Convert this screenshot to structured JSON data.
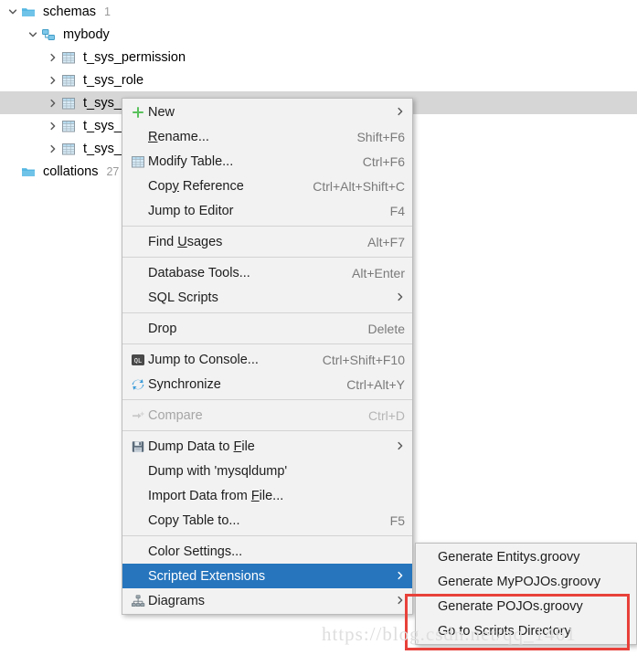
{
  "tree": {
    "rows": [
      {
        "label": "schemas",
        "count": "1",
        "indent": 0,
        "chevron": "down",
        "icon": "folder-icon",
        "selected": false
      },
      {
        "label": "mybody",
        "count": "",
        "indent": 1,
        "chevron": "down",
        "icon": "schema-icon",
        "selected": false
      },
      {
        "label": "t_sys_permission",
        "count": "",
        "indent": 2,
        "chevron": "right",
        "icon": "table-icon",
        "selected": false
      },
      {
        "label": "t_sys_role",
        "count": "",
        "indent": 2,
        "chevron": "right",
        "icon": "table-icon",
        "selected": false
      },
      {
        "label": "t_sys_",
        "count": "",
        "indent": 2,
        "chevron": "right",
        "icon": "table-icon",
        "selected": true
      },
      {
        "label": "t_sys_",
        "count": "",
        "indent": 2,
        "chevron": "right",
        "icon": "table-icon",
        "selected": false
      },
      {
        "label": "t_sys_",
        "count": "",
        "indent": 2,
        "chevron": "right",
        "icon": "table-icon",
        "selected": false
      },
      {
        "label": "collations",
        "count": "27",
        "indent": 0,
        "chevron": "",
        "icon": "folder-icon",
        "selected": false
      }
    ]
  },
  "context_menu": {
    "items": [
      {
        "type": "item",
        "label": "New",
        "accel": "",
        "icon": "plus-icon",
        "arrow": true,
        "disabled": false,
        "selected": false
      },
      {
        "type": "item",
        "label": "Rename...",
        "accel": "Shift+F6",
        "icon": "",
        "arrow": false,
        "disabled": false,
        "selected": false,
        "mnemonic": "R"
      },
      {
        "type": "item",
        "label": "Modify Table...",
        "accel": "Ctrl+F6",
        "icon": "table-icon",
        "arrow": false,
        "disabled": false,
        "selected": false
      },
      {
        "type": "item",
        "label": "Copy Reference",
        "accel": "Ctrl+Alt+Shift+C",
        "icon": "",
        "arrow": false,
        "disabled": false,
        "selected": false,
        "mnemonic": "y"
      },
      {
        "type": "item",
        "label": "Jump to Editor",
        "accel": "F4",
        "icon": "",
        "arrow": false,
        "disabled": false,
        "selected": false
      },
      {
        "type": "separator"
      },
      {
        "type": "item",
        "label": "Find Usages",
        "accel": "Alt+F7",
        "icon": "",
        "arrow": false,
        "disabled": false,
        "selected": false,
        "mnemonic": "U"
      },
      {
        "type": "separator"
      },
      {
        "type": "item",
        "label": "Database Tools...",
        "accel": "Alt+Enter",
        "icon": "",
        "arrow": false,
        "disabled": false,
        "selected": false
      },
      {
        "type": "item",
        "label": "SQL Scripts",
        "accel": "",
        "icon": "",
        "arrow": true,
        "disabled": false,
        "selected": false
      },
      {
        "type": "separator"
      },
      {
        "type": "item",
        "label": "Drop",
        "accel": "Delete",
        "icon": "",
        "arrow": false,
        "disabled": false,
        "selected": false
      },
      {
        "type": "separator"
      },
      {
        "type": "item",
        "label": "Jump to Console...",
        "accel": "Ctrl+Shift+F10",
        "icon": "sql-console-icon",
        "arrow": false,
        "disabled": false,
        "selected": false
      },
      {
        "type": "item",
        "label": "Synchronize",
        "accel": "Ctrl+Alt+Y",
        "icon": "sync-icon",
        "arrow": false,
        "disabled": false,
        "selected": false
      },
      {
        "type": "separator"
      },
      {
        "type": "item",
        "label": "Compare",
        "accel": "Ctrl+D",
        "icon": "compare-icon",
        "arrow": false,
        "disabled": true,
        "selected": false
      },
      {
        "type": "separator"
      },
      {
        "type": "item",
        "label": "Dump Data to File",
        "accel": "",
        "icon": "save-icon",
        "arrow": true,
        "disabled": false,
        "selected": false,
        "mnemonic": "F"
      },
      {
        "type": "item",
        "label": "Dump with 'mysqldump'",
        "accel": "",
        "icon": "",
        "arrow": false,
        "disabled": false,
        "selected": false
      },
      {
        "type": "item",
        "label": "Import Data from File...",
        "accel": "",
        "icon": "",
        "arrow": false,
        "disabled": false,
        "selected": false,
        "mnemonic": "F"
      },
      {
        "type": "item",
        "label": "Copy Table to...",
        "accel": "F5",
        "icon": "",
        "arrow": false,
        "disabled": false,
        "selected": false
      },
      {
        "type": "separator"
      },
      {
        "type": "item",
        "label": "Color Settings...",
        "accel": "",
        "icon": "",
        "arrow": false,
        "disabled": false,
        "selected": false
      },
      {
        "type": "item",
        "label": "Scripted Extensions",
        "accel": "",
        "icon": "",
        "arrow": true,
        "disabled": false,
        "selected": true
      },
      {
        "type": "item",
        "label": "Diagrams",
        "accel": "",
        "icon": "diagram-icon",
        "arrow": true,
        "disabled": false,
        "selected": false
      }
    ]
  },
  "submenu": {
    "items": [
      {
        "label": "Generate Entitys.groovy"
      },
      {
        "label": "Generate MyPOJOs.groovy"
      },
      {
        "label": "Generate POJOs.groovy"
      },
      {
        "label": "Go to Scripts Directory"
      }
    ]
  },
  "annotation": {
    "highlight_color": "#e8413a"
  },
  "watermark": {
    "text": "https://blog.csdn.net/qq_1461"
  },
  "colors": {
    "menu_background": "#f2f2f2",
    "menu_border": "#bcbcbc",
    "selection_blue": "#2675bd",
    "tree_selection_gray": "#d6d6d6",
    "accel_text": "#7a7a7a",
    "disabled_text": "#a6a6a6"
  }
}
